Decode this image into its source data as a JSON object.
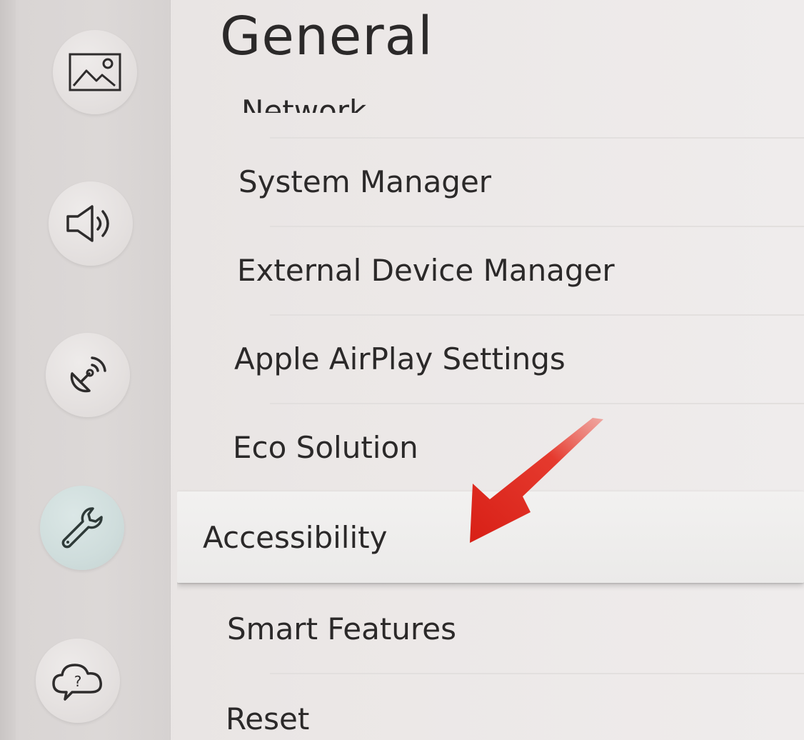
{
  "title": "General",
  "menu": {
    "items": [
      {
        "label": "Network"
      },
      {
        "label": "System Manager"
      },
      {
        "label": "External Device Manager"
      },
      {
        "label": "Apple AirPlay Settings"
      },
      {
        "label": "Eco Solution"
      },
      {
        "label": "Accessibility"
      },
      {
        "label": "Smart Features"
      },
      {
        "label": "Reset"
      }
    ],
    "selected_label": "Accessibility"
  },
  "sidebar": {
    "items": [
      {
        "icon": "picture-icon"
      },
      {
        "icon": "sound-icon"
      },
      {
        "icon": "broadcasting-icon"
      },
      {
        "icon": "wrench-icon",
        "active": true
      },
      {
        "icon": "support-icon"
      }
    ]
  },
  "colors": {
    "background": "#ebe7e6",
    "rail": "#d9d5d4",
    "active_icon_bg": "#cfdddc",
    "selected_row": "#efeeed",
    "text": "#2b2929",
    "arrow": "#e02b20"
  }
}
